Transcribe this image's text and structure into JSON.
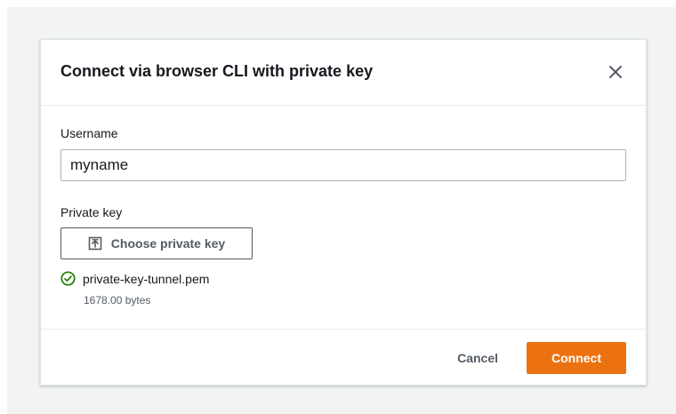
{
  "modal": {
    "title": "Connect via browser CLI with private key"
  },
  "form": {
    "username_label": "Username",
    "username_value": "myname",
    "private_key_label": "Private key",
    "choose_button_label": "Choose private key",
    "file": {
      "name": "private-key-tunnel.pem",
      "size": "1678.00 bytes",
      "status": "success"
    }
  },
  "footer": {
    "cancel_label": "Cancel",
    "connect_label": "Connect"
  },
  "colors": {
    "primary_button": "#ec7211",
    "success_icon": "#1d8102",
    "backdrop": "#f2f3f3",
    "text": "#16191f"
  },
  "icons": {
    "close": "close-icon",
    "upload": "upload-icon",
    "success": "check-circle-icon"
  }
}
